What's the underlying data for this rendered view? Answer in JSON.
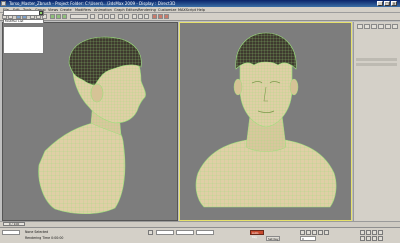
{
  "window": {
    "title": "Torso_Master_Zbrush - Project Folder: C:\\Users\\...\\3dsMax 2009 - Display : Direct3D",
    "minimize_label": "_",
    "maximize_label": "□",
    "close_label": "×"
  },
  "menu": {
    "items": [
      "File",
      "Edit",
      "Tools",
      "Group",
      "Views",
      "Create",
      "Modifiers",
      "Animation",
      "Graph Editors",
      "Rendering",
      "Customize",
      "MAXScript",
      "Help"
    ]
  },
  "viewports": {
    "left_label": "",
    "right_label": ""
  },
  "command_panel": {
    "object_name": "",
    "modifier_stack_label": "Modifier List"
  },
  "timeline": {
    "frame_indicator": "0 / 100"
  },
  "status": {
    "selection_text": "None Selected",
    "prompt_text": "Rendering Time 0:00:00",
    "auto_key_label": "Auto Key",
    "set_key_label": "Set Key",
    "frame_value": "0"
  },
  "colors": {
    "viewport_bg": "#7d7d7d",
    "active_viewport_border": "#e6e16b",
    "mesh_wire": "#9be07a",
    "skin": "#e0cfa6",
    "hair": "#3f3a2f"
  }
}
